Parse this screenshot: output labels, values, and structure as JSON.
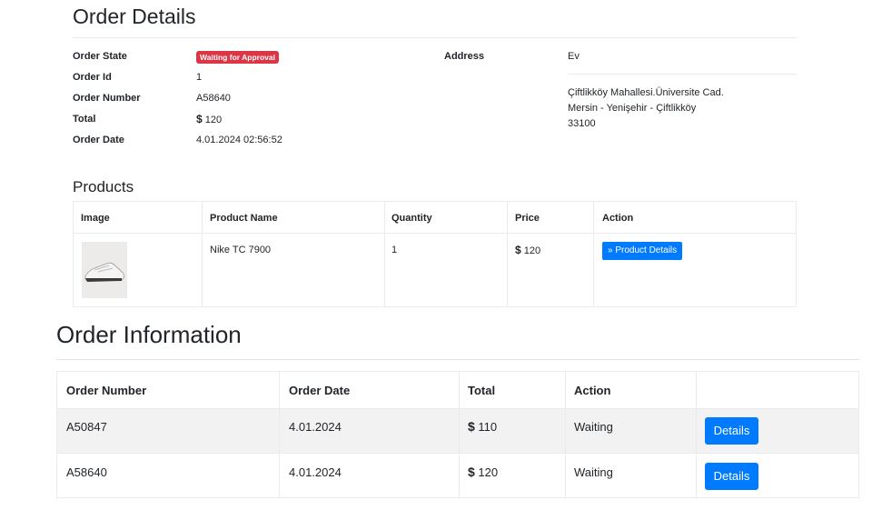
{
  "order_details": {
    "title": "Order Details",
    "labels": {
      "state": "Order State",
      "id": "Order Id",
      "number": "Order Number",
      "total": "Total",
      "date": "Order Date",
      "address": "Address"
    },
    "values": {
      "state_badge": "Waiting for Approval",
      "id": "1",
      "number": "A58640",
      "total_currency": "$",
      "total_amount": "120",
      "date": "4.01.2024 02:56:52"
    },
    "address": {
      "name": "Ev",
      "line1": "Çiftlikköy Mahallesi.Üniversite Cad.",
      "line2": "Mersin - Yenişehir - Çiftlikköy",
      "line3": "33100"
    },
    "colors": {
      "badge": "#dc3545",
      "primary": "#007bff"
    }
  },
  "products": {
    "title": "Products",
    "headers": [
      "Image",
      "Product Name",
      "Quantity",
      "Price",
      "Action"
    ],
    "rows": [
      {
        "image_icon": "sneaker-image",
        "name": "Nike TC 7900",
        "quantity": "1",
        "price_currency": "$",
        "price_amount": "120",
        "action_label": "» Product Details"
      }
    ]
  },
  "order_information": {
    "title": "Order Information",
    "headers": [
      "Order Number",
      "Order Date",
      "Total",
      "Action",
      ""
    ],
    "rows": [
      {
        "number": "A50847",
        "date": "4.01.2024",
        "currency": "$",
        "total": "110",
        "status": "Waiting",
        "button": "Details"
      },
      {
        "number": "A58640",
        "date": "4.01.2024",
        "currency": "$",
        "total": "120",
        "status": "Waiting",
        "button": "Details"
      }
    ]
  }
}
